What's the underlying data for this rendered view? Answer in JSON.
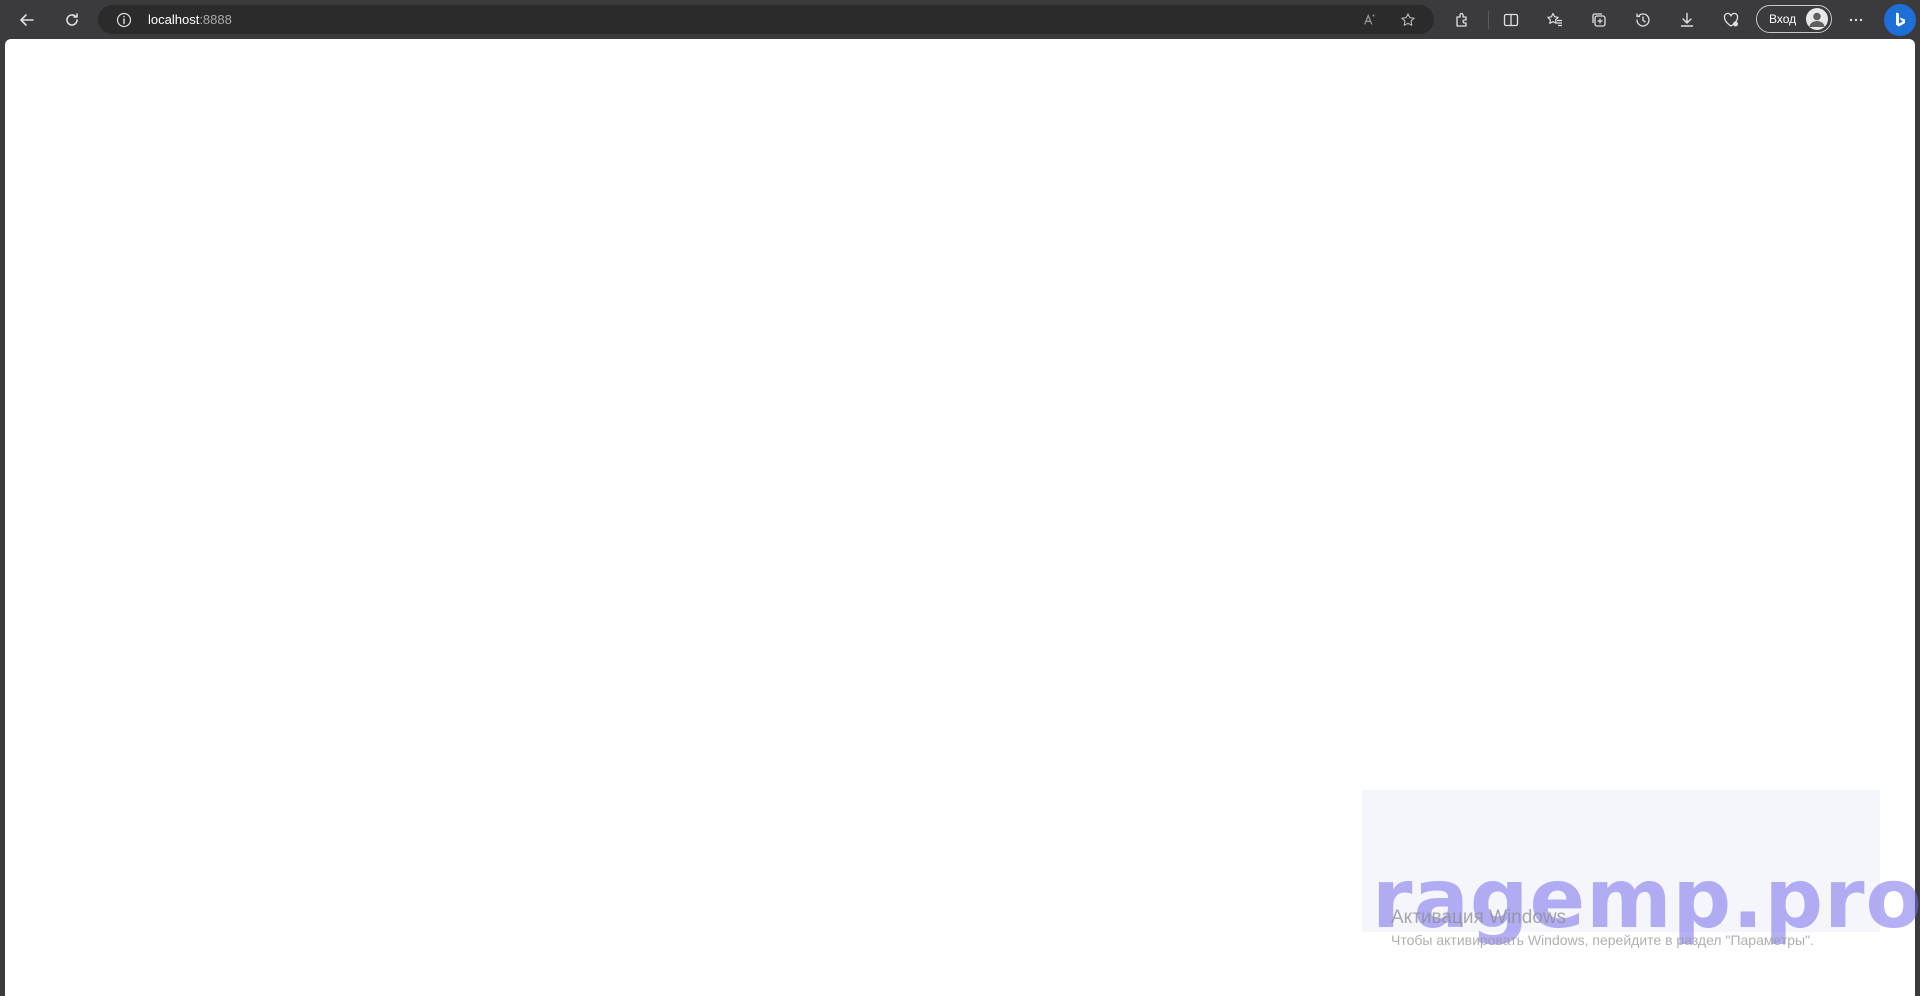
{
  "browser": {
    "address_bar": {
      "host": "localhost",
      "port": ":8888",
      "info_icon": "info-icon"
    },
    "toolbar_icons": [
      "back-arrow-icon",
      "refresh-icon",
      "read-aloud-icon",
      "favorite-star-icon",
      "extensions-icon",
      "split-screen-icon",
      "favorites-icon",
      "collections-icon",
      "history-icon",
      "downloads-icon",
      "browser-essentials-icon",
      "more-options-icon",
      "bing-copilot-icon"
    ],
    "signin_label": "Вход"
  },
  "overlay": {
    "watermark_text": "ragemp.pro",
    "activation_title": "Активация Windows",
    "activation_text": "Чтобы активировать Windows, перейдите в раздел \"Параметры\"."
  }
}
